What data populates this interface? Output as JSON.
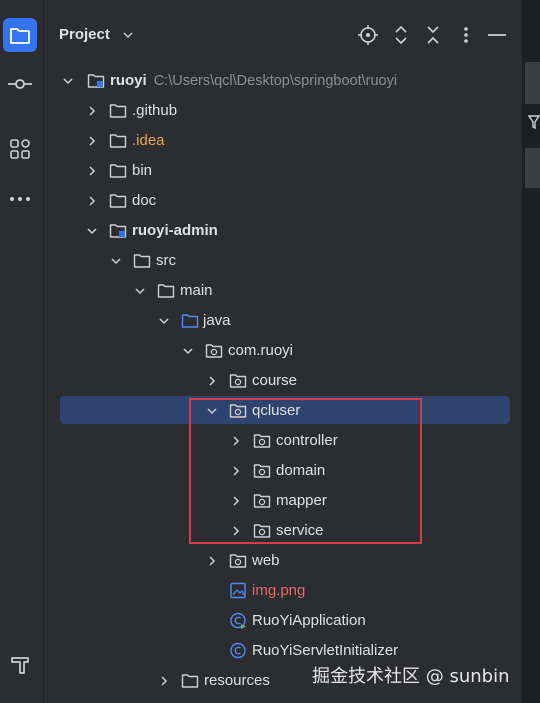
{
  "panel": {
    "title": "Project"
  },
  "activity_bar": [
    {
      "name": "project-folder-icon",
      "active": true
    },
    {
      "name": "commit-icon",
      "active": false
    },
    {
      "name": "structure-icon",
      "active": false
    },
    {
      "name": "more-icon",
      "active": false
    },
    {
      "name": "build-hammer-icon",
      "active": false
    }
  ],
  "header_actions": [
    "locate-icon",
    "expand-collapse-icon",
    "collapse-all-icon",
    "options-kebab-icon",
    "hide-panel-icon"
  ],
  "tree": {
    "root": {
      "label": "ruoyi",
      "path": "C:\\Users\\qcl\\Desktop\\springboot\\ruoyi"
    },
    "items": [
      {
        "label": ".github"
      },
      {
        "label": ".idea"
      },
      {
        "label": "bin"
      },
      {
        "label": "doc"
      },
      {
        "label": "ruoyi-admin"
      },
      {
        "label": "src"
      },
      {
        "label": "main"
      },
      {
        "label": "java"
      },
      {
        "label": "com.ruoyi"
      },
      {
        "label": "course"
      },
      {
        "label": "qcluser"
      },
      {
        "label": "controller"
      },
      {
        "label": "domain"
      },
      {
        "label": "mapper"
      },
      {
        "label": "service"
      },
      {
        "label": "web"
      },
      {
        "label": "img.png"
      },
      {
        "label": "RuoYiApplication"
      },
      {
        "label": "RuoYiServletInitializer"
      },
      {
        "label": "resources"
      }
    ]
  },
  "watermark": "掘金技术社区 @ sunbin",
  "colors": {
    "background": "#2b2d30",
    "selection": "#2e436e",
    "accent": "#3574f0",
    "highlight_box": "#d73a49",
    "idea_folder_text": "#e8a55a",
    "image_file_text": "#e06c64"
  }
}
